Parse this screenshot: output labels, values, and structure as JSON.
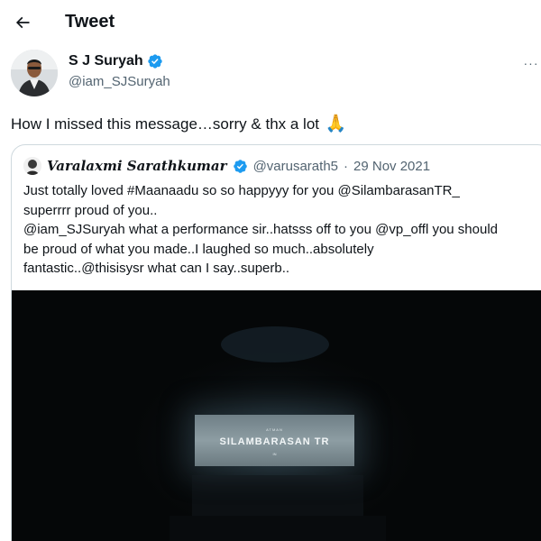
{
  "header": {
    "back_icon": "arrow-left-icon",
    "title": "Tweet"
  },
  "author": {
    "name": "S J Suryah",
    "handle": "@iam_SJSuryah",
    "verified_icon": "verified-badge-icon",
    "more_icon": "more-horizontal-icon",
    "more_label": "···"
  },
  "tweet": {
    "text": "How I missed this message…sorry &  thx a lot",
    "emoji": "🙏"
  },
  "quoted": {
    "name": "Varalaxmi Sarathkumar",
    "handle": "@varusarath5",
    "separator": "·",
    "date": "29 Nov 2021",
    "lines": [
      "Just totally loved #Maanaadu so so happyyy for you @SilambarasanTR_",
      "superrrr proud of you..",
      "@iam_SJSuryah what a performance sir..hatsss off to you @vp_offl you should",
      "be proud of what you made..I laughed so much..absolutely",
      "fantastic..@thisisysr what can I say..superb.."
    ],
    "media": {
      "screen_small": "ATMAN",
      "screen_title": "SILAMBARASAN TR",
      "screen_small2": "IN"
    }
  },
  "colors": {
    "primary_text": "#0f1419",
    "secondary_text": "#536471",
    "verified": "#1d9bf0",
    "border": "#cfd9de",
    "media_bg": "#050708"
  }
}
